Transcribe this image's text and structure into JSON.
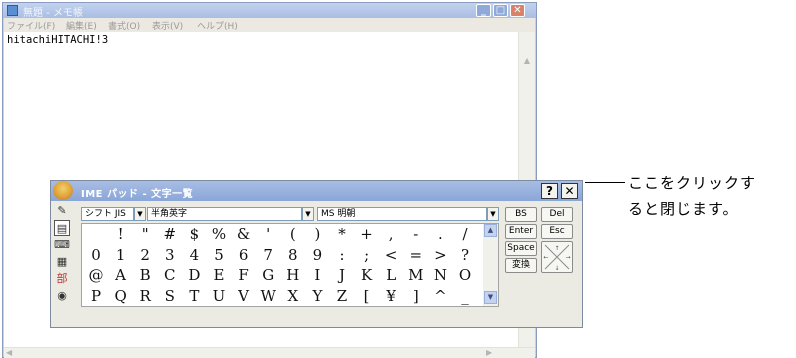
{
  "notepad": {
    "title": "無題 - メモ帳",
    "menu": [
      "ファイル(F)",
      "編集(E)",
      "書式(O)",
      "表示(V)",
      "ヘルプ(H)"
    ],
    "content": "hitachiHITACHI!3",
    "window_buttons": {
      "minimize": "_",
      "maximize": "□",
      "close": "✕"
    }
  },
  "ime_pad": {
    "title": "IME パッド - 文字一覧",
    "help_label": "?",
    "close_label": "✕",
    "charset_select": "シフト JIS",
    "category_select": "半角英字",
    "font_select": "MS 明朝",
    "tool_icons": [
      "pen-icon",
      "list-icon",
      "keyboard-icon",
      "radical-icon",
      "stroke-icon",
      "soft-keyboard-icon"
    ],
    "char_rows": [
      [
        " ",
        "!",
        "\"",
        "#",
        "$",
        "%",
        "&",
        "'",
        "(",
        ")",
        "*",
        "+",
        ",",
        "-",
        ".",
        "/"
      ],
      [
        "0",
        "1",
        "2",
        "3",
        "4",
        "5",
        "6",
        "7",
        "8",
        "9",
        ":",
        ";",
        "<",
        "=",
        ">",
        "?"
      ],
      [
        "@",
        "A",
        "B",
        "C",
        "D",
        "E",
        "F",
        "G",
        "H",
        "I",
        "J",
        "K",
        "L",
        "M",
        "N",
        "O"
      ],
      [
        "P",
        "Q",
        "R",
        "S",
        "T",
        "U",
        "V",
        "W",
        "X",
        "Y",
        "Z",
        "[",
        "¥",
        "]",
        "^",
        "_"
      ]
    ],
    "buttons": {
      "bs": "BS",
      "del": "Del",
      "enter": "Enter",
      "esc": "Esc",
      "space": "Space",
      "convert": "変換"
    }
  },
  "callout": {
    "line1": "ここをクリックす",
    "line2": "ると閉じます。"
  }
}
